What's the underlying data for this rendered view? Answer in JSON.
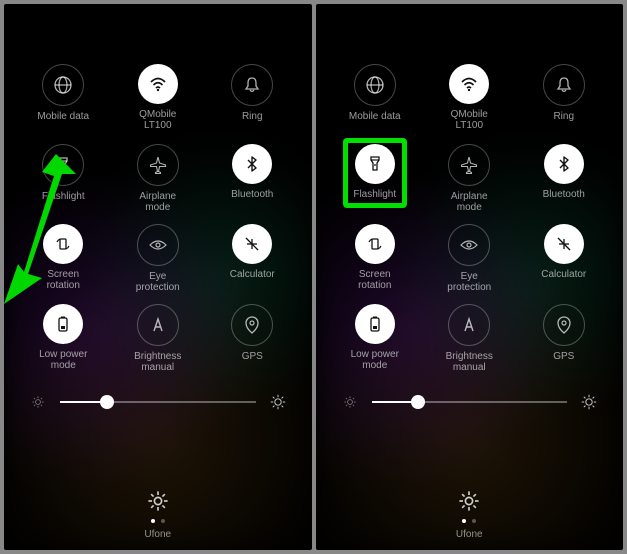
{
  "carrier": "Ufone",
  "brightness_percent": 24,
  "panels": [
    {
      "id": "left",
      "show_arrow": true,
      "tiles": [
        {
          "id": "mobile-data",
          "label": "Mobile data",
          "active": false,
          "icon": "globe"
        },
        {
          "id": "wifi",
          "label": "QMobile\nLT100",
          "active": true,
          "icon": "wifi"
        },
        {
          "id": "ring",
          "label": "Ring",
          "active": false,
          "icon": "bell"
        },
        {
          "id": "flashlight",
          "label": "Flashlight",
          "active": false,
          "icon": "flashlight",
          "highlight": false
        },
        {
          "id": "airplane",
          "label": "Airplane\nmode",
          "active": false,
          "icon": "airplane"
        },
        {
          "id": "bluetooth",
          "label": "Bluetooth",
          "active": true,
          "icon": "bluetooth"
        },
        {
          "id": "rotation",
          "label": "Screen\nrotation",
          "active": true,
          "icon": "rotation"
        },
        {
          "id": "eye",
          "label": "Eye\nprotection",
          "active": false,
          "icon": "eye"
        },
        {
          "id": "calc",
          "label": "Calculator",
          "active": true,
          "icon": "calc"
        },
        {
          "id": "lowpower",
          "label": "Low power\nmode",
          "active": true,
          "icon": "battery"
        },
        {
          "id": "brightmanual",
          "label": "Brightness\nmanual",
          "active": false,
          "icon": "auto-a"
        },
        {
          "id": "gps",
          "label": "GPS",
          "active": false,
          "icon": "gps"
        }
      ]
    },
    {
      "id": "right",
      "show_arrow": false,
      "tiles": [
        {
          "id": "mobile-data",
          "label": "Mobile data",
          "active": false,
          "icon": "globe"
        },
        {
          "id": "wifi",
          "label": "QMobile\nLT100",
          "active": true,
          "icon": "wifi"
        },
        {
          "id": "ring",
          "label": "Ring",
          "active": false,
          "icon": "bell"
        },
        {
          "id": "flashlight",
          "label": "Flashlight",
          "active": true,
          "icon": "flashlight",
          "highlight": true
        },
        {
          "id": "airplane",
          "label": "Airplane\nmode",
          "active": false,
          "icon": "airplane"
        },
        {
          "id": "bluetooth",
          "label": "Bluetooth",
          "active": true,
          "icon": "bluetooth"
        },
        {
          "id": "rotation",
          "label": "Screen\nrotation",
          "active": true,
          "icon": "rotation"
        },
        {
          "id": "eye",
          "label": "Eye\nprotection",
          "active": false,
          "icon": "eye"
        },
        {
          "id": "calc",
          "label": "Calculator",
          "active": true,
          "icon": "calc"
        },
        {
          "id": "lowpower",
          "label": "Low power\nmode",
          "active": true,
          "icon": "battery"
        },
        {
          "id": "brightmanual",
          "label": "Brightness\nmanual",
          "active": false,
          "icon": "auto-a"
        },
        {
          "id": "gps",
          "label": "GPS",
          "active": false,
          "icon": "gps"
        }
      ]
    }
  ]
}
